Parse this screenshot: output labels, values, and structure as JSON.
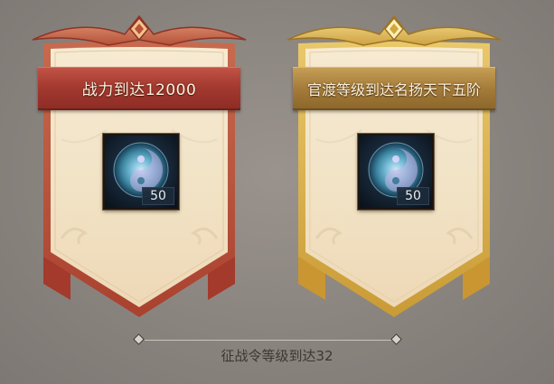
{
  "rewards": [
    {
      "title": "战力到达12000",
      "theme": "red",
      "item_icon": "swirl-orb-icon",
      "item_count": "50"
    },
    {
      "title": "官渡等级到达名扬天下五阶",
      "theme": "gold",
      "item_icon": "swirl-orb-icon",
      "item_count": "50"
    }
  ],
  "footer": {
    "caption": "征战令等级到达32"
  },
  "colors": {
    "background": "#8a847f",
    "red_ribbon": "#a43a30",
    "gold_ribbon": "#a57c3a",
    "banner_cream": "#f3e6cd",
    "badge_bg": "#1c2a3a"
  }
}
